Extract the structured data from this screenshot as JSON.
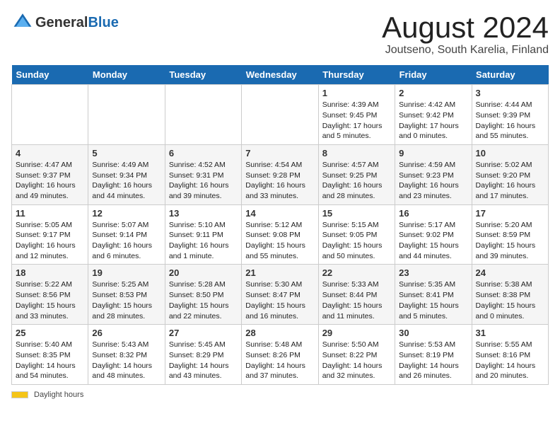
{
  "header": {
    "logo_general": "General",
    "logo_blue": "Blue",
    "month_title": "August 2024",
    "location": "Joutseno, South Karelia, Finland"
  },
  "days_of_week": [
    "Sunday",
    "Monday",
    "Tuesday",
    "Wednesday",
    "Thursday",
    "Friday",
    "Saturday"
  ],
  "weeks": [
    [
      {
        "day": "",
        "info": ""
      },
      {
        "day": "",
        "info": ""
      },
      {
        "day": "",
        "info": ""
      },
      {
        "day": "",
        "info": ""
      },
      {
        "day": "1",
        "info": "Sunrise: 4:39 AM\nSunset: 9:45 PM\nDaylight: 17 hours\nand 5 minutes."
      },
      {
        "day": "2",
        "info": "Sunrise: 4:42 AM\nSunset: 9:42 PM\nDaylight: 17 hours\nand 0 minutes."
      },
      {
        "day": "3",
        "info": "Sunrise: 4:44 AM\nSunset: 9:39 PM\nDaylight: 16 hours\nand 55 minutes."
      }
    ],
    [
      {
        "day": "4",
        "info": "Sunrise: 4:47 AM\nSunset: 9:37 PM\nDaylight: 16 hours\nand 49 minutes."
      },
      {
        "day": "5",
        "info": "Sunrise: 4:49 AM\nSunset: 9:34 PM\nDaylight: 16 hours\nand 44 minutes."
      },
      {
        "day": "6",
        "info": "Sunrise: 4:52 AM\nSunset: 9:31 PM\nDaylight: 16 hours\nand 39 minutes."
      },
      {
        "day": "7",
        "info": "Sunrise: 4:54 AM\nSunset: 9:28 PM\nDaylight: 16 hours\nand 33 minutes."
      },
      {
        "day": "8",
        "info": "Sunrise: 4:57 AM\nSunset: 9:25 PM\nDaylight: 16 hours\nand 28 minutes."
      },
      {
        "day": "9",
        "info": "Sunrise: 4:59 AM\nSunset: 9:23 PM\nDaylight: 16 hours\nand 23 minutes."
      },
      {
        "day": "10",
        "info": "Sunrise: 5:02 AM\nSunset: 9:20 PM\nDaylight: 16 hours\nand 17 minutes."
      }
    ],
    [
      {
        "day": "11",
        "info": "Sunrise: 5:05 AM\nSunset: 9:17 PM\nDaylight: 16 hours\nand 12 minutes."
      },
      {
        "day": "12",
        "info": "Sunrise: 5:07 AM\nSunset: 9:14 PM\nDaylight: 16 hours\nand 6 minutes."
      },
      {
        "day": "13",
        "info": "Sunrise: 5:10 AM\nSunset: 9:11 PM\nDaylight: 16 hours\nand 1 minute."
      },
      {
        "day": "14",
        "info": "Sunrise: 5:12 AM\nSunset: 9:08 PM\nDaylight: 15 hours\nand 55 minutes."
      },
      {
        "day": "15",
        "info": "Sunrise: 5:15 AM\nSunset: 9:05 PM\nDaylight: 15 hours\nand 50 minutes."
      },
      {
        "day": "16",
        "info": "Sunrise: 5:17 AM\nSunset: 9:02 PM\nDaylight: 15 hours\nand 44 minutes."
      },
      {
        "day": "17",
        "info": "Sunrise: 5:20 AM\nSunset: 8:59 PM\nDaylight: 15 hours\nand 39 minutes."
      }
    ],
    [
      {
        "day": "18",
        "info": "Sunrise: 5:22 AM\nSunset: 8:56 PM\nDaylight: 15 hours\nand 33 minutes."
      },
      {
        "day": "19",
        "info": "Sunrise: 5:25 AM\nSunset: 8:53 PM\nDaylight: 15 hours\nand 28 minutes."
      },
      {
        "day": "20",
        "info": "Sunrise: 5:28 AM\nSunset: 8:50 PM\nDaylight: 15 hours\nand 22 minutes."
      },
      {
        "day": "21",
        "info": "Sunrise: 5:30 AM\nSunset: 8:47 PM\nDaylight: 15 hours\nand 16 minutes."
      },
      {
        "day": "22",
        "info": "Sunrise: 5:33 AM\nSunset: 8:44 PM\nDaylight: 15 hours\nand 11 minutes."
      },
      {
        "day": "23",
        "info": "Sunrise: 5:35 AM\nSunset: 8:41 PM\nDaylight: 15 hours\nand 5 minutes."
      },
      {
        "day": "24",
        "info": "Sunrise: 5:38 AM\nSunset: 8:38 PM\nDaylight: 15 hours\nand 0 minutes."
      }
    ],
    [
      {
        "day": "25",
        "info": "Sunrise: 5:40 AM\nSunset: 8:35 PM\nDaylight: 14 hours\nand 54 minutes."
      },
      {
        "day": "26",
        "info": "Sunrise: 5:43 AM\nSunset: 8:32 PM\nDaylight: 14 hours\nand 48 minutes."
      },
      {
        "day": "27",
        "info": "Sunrise: 5:45 AM\nSunset: 8:29 PM\nDaylight: 14 hours\nand 43 minutes."
      },
      {
        "day": "28",
        "info": "Sunrise: 5:48 AM\nSunset: 8:26 PM\nDaylight: 14 hours\nand 37 minutes."
      },
      {
        "day": "29",
        "info": "Sunrise: 5:50 AM\nSunset: 8:22 PM\nDaylight: 14 hours\nand 32 minutes."
      },
      {
        "day": "30",
        "info": "Sunrise: 5:53 AM\nSunset: 8:19 PM\nDaylight: 14 hours\nand 26 minutes."
      },
      {
        "day": "31",
        "info": "Sunrise: 5:55 AM\nSunset: 8:16 PM\nDaylight: 14 hours\nand 20 minutes."
      }
    ]
  ],
  "footer": {
    "daylight_label": "Daylight hours"
  }
}
